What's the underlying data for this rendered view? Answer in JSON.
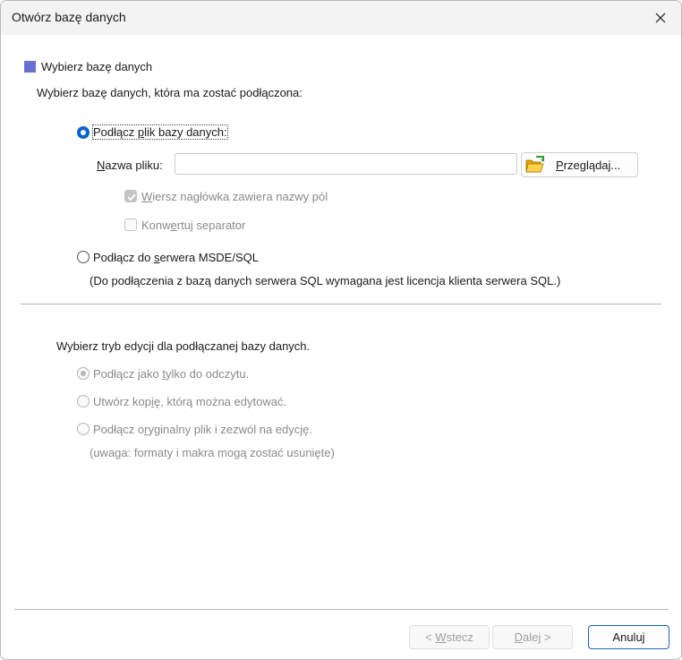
{
  "window": {
    "title": "Otwórz bazę danych"
  },
  "section": {
    "heading": "Wybierz bazę danych",
    "instruction": "Wybierz bazę danych, która ma zostać podłączona:"
  },
  "connect_file": {
    "label": "Podłącz plik bazy danych:",
    "selected": true,
    "filename_label": "Nazwa pliku:",
    "filename_value": "",
    "browse_label": "Przeglądaj...",
    "header_row_label": "Wiersz nagłówka zawiera nazwy pól",
    "header_row_checked": true,
    "convert_separator_label": "Konwertuj separator",
    "convert_separator_checked": false
  },
  "connect_server": {
    "label": "Podłącz do serwera MSDE/SQL",
    "selected": false,
    "note": "(Do podłączenia z bazą danych serwera SQL wymagana jest licencja klienta serwera SQL.)"
  },
  "edit_mode": {
    "heading": "Wybierz tryb edycji dla podłączanej bazy danych.",
    "options": [
      {
        "label": "Podłącz jako tylko do odczytu.",
        "selected": true
      },
      {
        "label": "Utwórz kopię, którą można edytować.",
        "selected": false
      },
      {
        "label": "Podłącz oryginalny plik i zezwól na edycję.",
        "selected": false
      }
    ],
    "note": "(uwaga: formaty i makra mogą zostać usunięte)"
  },
  "footer": {
    "back_label": "< Wstecz",
    "next_label": "Dalej >",
    "cancel_label": "Anuluj"
  },
  "colors": {
    "accent": "#0a64c8",
    "section_icon": "#6a6fd2",
    "folder_icon": "#f0b400"
  }
}
